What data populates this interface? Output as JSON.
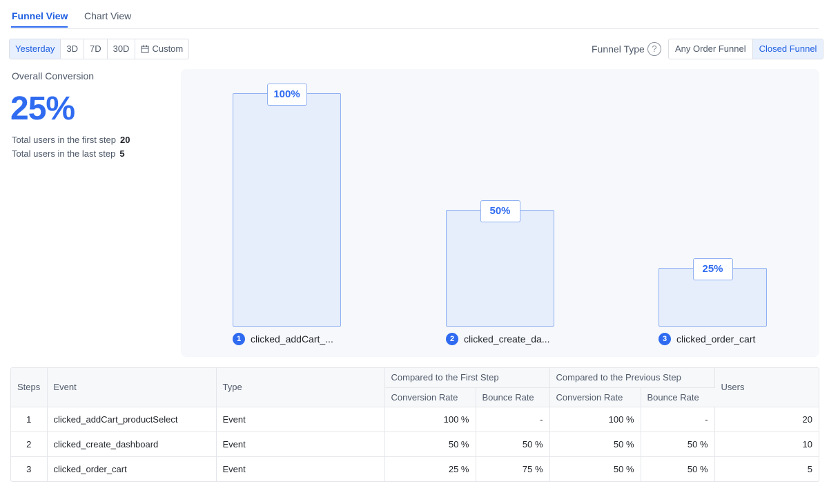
{
  "tabs": [
    {
      "label": "Funnel View",
      "active": true
    },
    {
      "label": "Chart View",
      "active": false
    }
  ],
  "period": {
    "options": [
      "Yesterday",
      "3D",
      "7D",
      "30D",
      "Custom"
    ],
    "selected": "Yesterday"
  },
  "funnel_type": {
    "label": "Funnel Type",
    "help_icon": "question-circle-icon",
    "options": [
      "Any Order Funnel",
      "Closed Funnel"
    ],
    "selected": "Closed Funnel"
  },
  "overall": {
    "label": "Overall Conversion",
    "value": "25%",
    "first_step_label": "Total users in the first step",
    "first_step_value": "20",
    "last_step_label": "Total users in the last step",
    "last_step_value": "5"
  },
  "colors": {
    "accent": "#2f6bf0",
    "bar_fill": "#e6edfb",
    "bar_border": "#8fb0f2"
  },
  "chart_data": {
    "type": "bar",
    "categories": [
      "clicked_addCart_...",
      "clicked_create_da...",
      "clicked_order_cart"
    ],
    "values": [
      100,
      50,
      25
    ],
    "value_labels": [
      "100%",
      "50%",
      "25%"
    ],
    "step_numbers": [
      "1",
      "2",
      "3"
    ],
    "ylim": [
      0,
      100
    ],
    "grid": false
  },
  "table": {
    "group_headers": [
      "Compared to the First Step",
      "Compared to the Previous Step"
    ],
    "headers": {
      "steps": "Steps",
      "event": "Event",
      "type": "Type",
      "first_conv": "Conversion Rate",
      "first_bounce": "Bounce Rate",
      "prev_conv": "Conversion Rate",
      "prev_bounce": "Bounce Rate",
      "users": "Users"
    },
    "rows": [
      {
        "step": "1",
        "event": "clicked_addCart_productSelect",
        "type": "Event",
        "first_conv": "100 %",
        "first_bounce": "-",
        "prev_conv": "100 %",
        "prev_bounce": "-",
        "users": "20"
      },
      {
        "step": "2",
        "event": "clicked_create_dashboard",
        "type": "Event",
        "first_conv": "50 %",
        "first_bounce": "50 %",
        "prev_conv": "50 %",
        "prev_bounce": "50 %",
        "users": "10"
      },
      {
        "step": "3",
        "event": "clicked_order_cart",
        "type": "Event",
        "first_conv": "25 %",
        "first_bounce": "75 %",
        "prev_conv": "50 %",
        "prev_bounce": "50 %",
        "users": "5"
      }
    ]
  }
}
